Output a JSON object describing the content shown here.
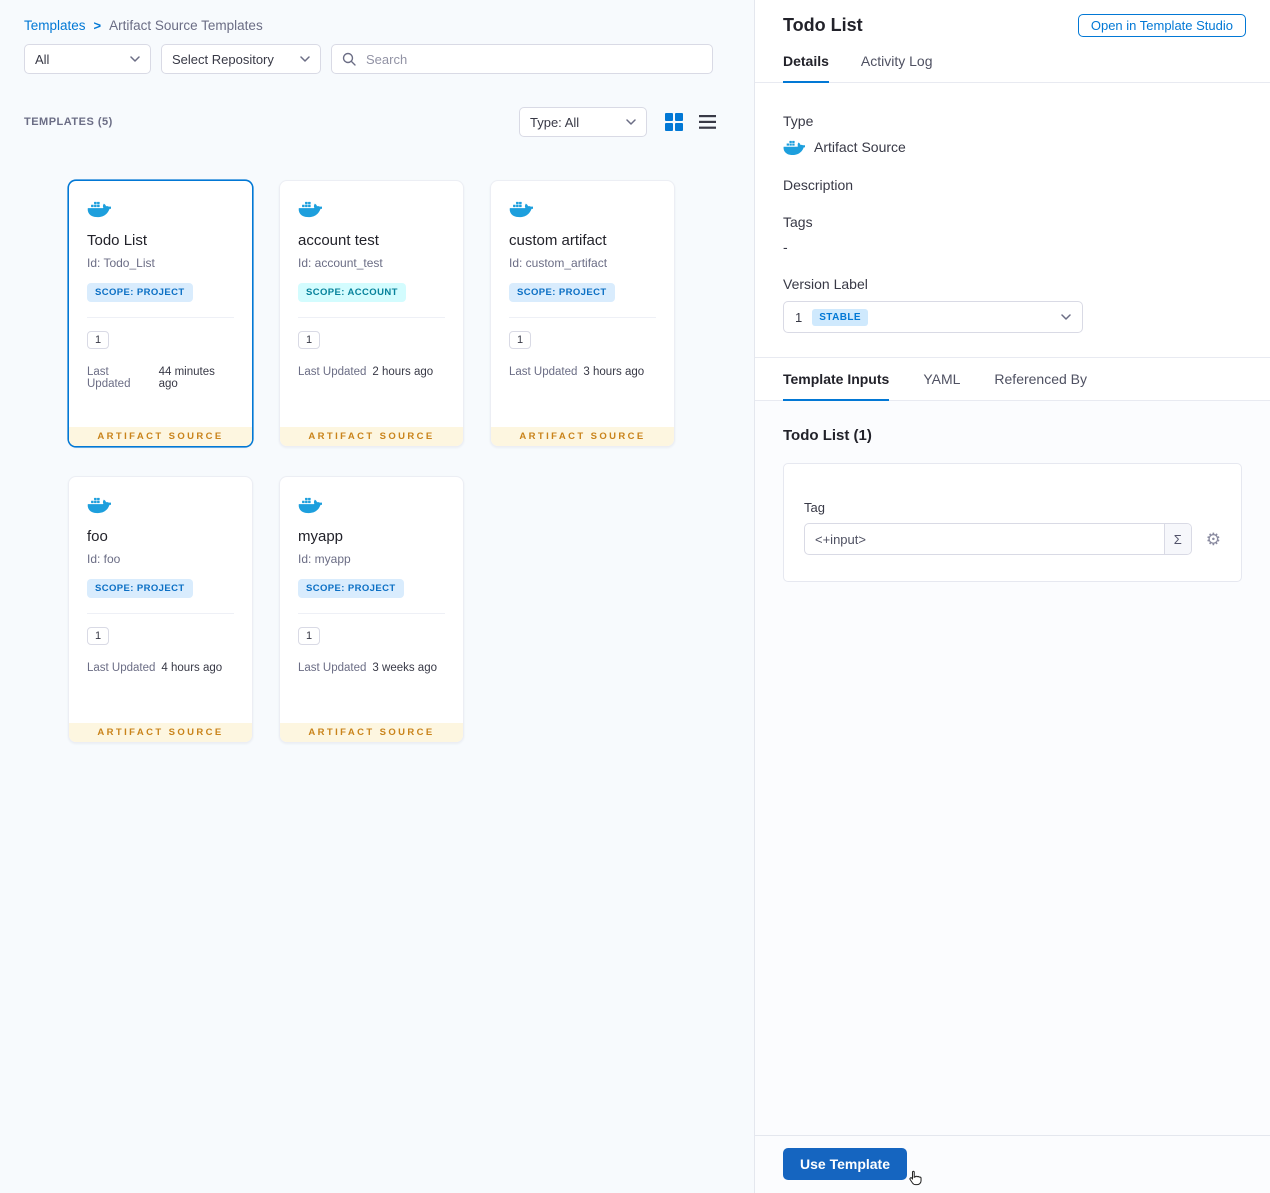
{
  "breadcrumb": {
    "root": "Templates",
    "separator": ">",
    "current": "Artifact Source Templates"
  },
  "filters": {
    "scope": "All",
    "repository": "Select Repository",
    "search_placeholder": "Search"
  },
  "list_header": {
    "count": "TEMPLATES (5)",
    "type_filter": "Type: All"
  },
  "labels": {
    "last_updated": "Last Updated",
    "card_footer": "ARTIFACT SOURCE"
  },
  "cards": [
    {
      "name": "Todo List",
      "id": "Id: Todo_List",
      "scope": "SCOPE: PROJECT",
      "version": "1",
      "last_updated": "44 minutes ago"
    },
    {
      "name": "account test",
      "id": "Id: account_test",
      "scope": "SCOPE: ACCOUNT",
      "version": "1",
      "last_updated": "2 hours ago"
    },
    {
      "name": "custom artifact",
      "id": "Id: custom_artifact",
      "scope": "SCOPE: PROJECT",
      "version": "1",
      "last_updated": "3 hours ago"
    },
    {
      "name": "foo",
      "id": "Id: foo",
      "scope": "SCOPE: PROJECT",
      "version": "1",
      "last_updated": "4 hours ago"
    },
    {
      "name": "myapp",
      "id": "Id: myapp",
      "scope": "SCOPE: PROJECT",
      "version": "1",
      "last_updated": "3 weeks ago"
    }
  ],
  "panel": {
    "title": "Todo List",
    "open_in_studio": "Open in Template Studio",
    "tabs": {
      "details": "Details",
      "activity_log": "Activity Log"
    },
    "fields": {
      "type_label": "Type",
      "type_value": "Artifact Source",
      "description_label": "Description",
      "tags_label": "Tags",
      "tags_value": "-",
      "version_label": "Version Label",
      "version_value": "1",
      "version_badge": "STABLE"
    },
    "input_tabs": {
      "template_inputs": "Template Inputs",
      "yaml": "YAML",
      "referenced_by": "Referenced By"
    },
    "inputs": {
      "section_title": "Todo List (1)",
      "tag_label": "Tag",
      "tag_value": "<+input>",
      "sigma": "Σ"
    },
    "use_template": "Use Template"
  },
  "icons": {
    "gear": "⚙"
  },
  "colors": {
    "primary": "#0278d5",
    "docker_blue": "#1d9fdd",
    "footer_orange": "#c9831a",
    "scope_project_bg": "#d9ecfd",
    "scope_account_bg": "#d3fcfe",
    "stable_badge_bg": "#cfe9fd",
    "use_template_bg": "#1565c0"
  }
}
